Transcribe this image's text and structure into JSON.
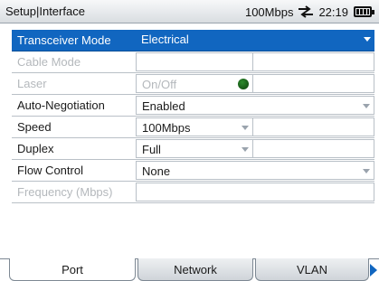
{
  "header": {
    "title": "Setup|Interface",
    "link_speed": "100Mbps",
    "clock": "22:19",
    "network_icon": "network-link-icon",
    "battery_icon": "battery-icon"
  },
  "fields": [
    {
      "label": "Transceiver Mode",
      "value": "Electrical",
      "selected": true,
      "enabled": true
    },
    {
      "label": "Cable Mode",
      "value": "",
      "enabled": false
    },
    {
      "label": "Laser",
      "value": "On/Off",
      "enabled": false,
      "indicator": "led-indicator-icon"
    },
    {
      "label": "Auto-Negotiation",
      "value": "Enabled",
      "enabled": true
    },
    {
      "label": "Speed",
      "value": "100Mbps",
      "enabled": true
    },
    {
      "label": "Duplex",
      "value": "Full",
      "enabled": true
    },
    {
      "label": "Flow Control",
      "value": "None",
      "enabled": true
    },
    {
      "label": "Frequency (Mbps)",
      "value": "",
      "enabled": false
    }
  ],
  "tabs": [
    {
      "label": "Port",
      "active": true
    },
    {
      "label": "Network",
      "active": false
    },
    {
      "label": "VLAN",
      "active": false
    }
  ],
  "colors": {
    "selection": "#1166c0",
    "disabled_text": "#b4b8bc",
    "led": "#1e6e1e"
  }
}
